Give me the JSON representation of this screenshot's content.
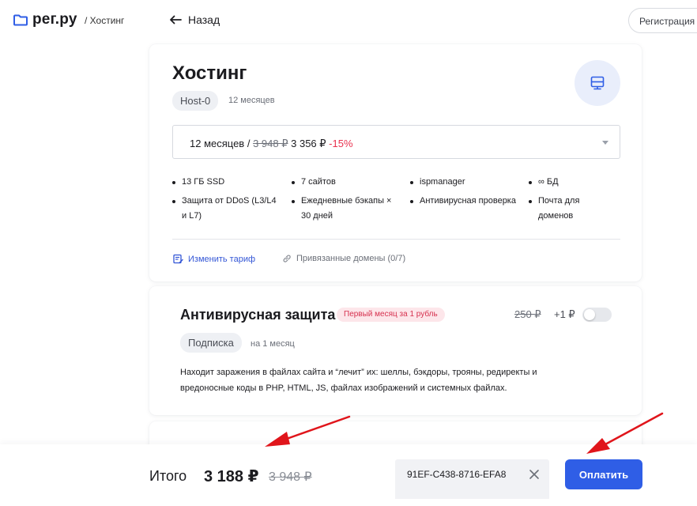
{
  "header": {
    "logo_text": "рег.ру",
    "breadcrumb": "/ Хостинг",
    "back_label": "Назад",
    "register_label": "Регистрация"
  },
  "hosting": {
    "title": "Хостинг",
    "plan": "Host-0",
    "term": "12 месяцев",
    "period": {
      "label": "12 месяцев /",
      "old_price": "3 948 ₽",
      "new_price": "3 356 ₽",
      "discount": "-15%"
    },
    "features": [
      [
        "13 ГБ SSD",
        "Защита от DDoS (L3/L4 и L7)"
      ],
      [
        "7 сайтов",
        "Ежедневные бэкапы × 30 дней"
      ],
      [
        "ispmanager",
        "Антивирусная проверка"
      ],
      [
        "∞ БД",
        "Почта для доменов"
      ]
    ],
    "links": {
      "change_plan": "Изменить тариф",
      "linked_domains": "Привязанные домены (0/7)"
    }
  },
  "antivirus": {
    "title": "Антивирусная защита",
    "promo_badge": "Первый месяц за 1 рубль",
    "old_price": "250 ₽",
    "new_price": "+1 ₽",
    "enabled": false,
    "chip": "Подписка",
    "term": "на 1 месяц",
    "description": "Находит заражения в файлах сайта и “лечит” их: шеллы, бэкдоры, трояны, редиректы и вредоносные коды в PHP, HTML, JS, файлах изображений и системных файлах."
  },
  "footer": {
    "total_label": "Итого",
    "total_value": "3 188 ₽",
    "total_old": "3 948 ₽",
    "promo_code_value": "91EF-C438-8716-EFA8",
    "pay_label": "Оплатить"
  },
  "colors": {
    "accent": "#2f5ee6",
    "discount_red": "#e9324f",
    "annotation_red": "#e0151b"
  }
}
